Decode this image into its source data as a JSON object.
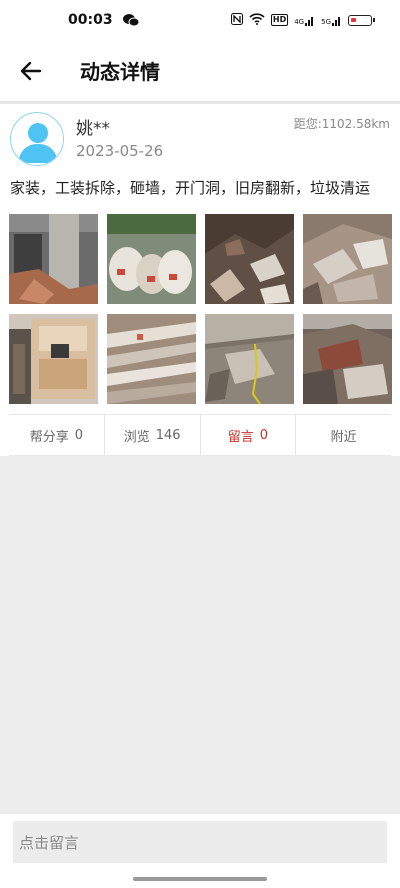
{
  "status_bar": {
    "time": "00:03",
    "hd_label": "HD",
    "signal_label_1": "4G",
    "signal_label_2": "5G"
  },
  "header": {
    "title": "动态详情"
  },
  "post": {
    "username": "姚**",
    "date": "2023-05-26",
    "distance": "距您:1102.58km",
    "description": "家装，工装拆除，砸墙，开门洞，旧房翻新，垃圾清运",
    "photos": [
      "debris-doorway-photo",
      "rubble-bags-photo",
      "broken-tiles-photo",
      "debris-pile-photo",
      "cabinet-room-photo",
      "wood-planks-photo",
      "rubble-floor-photo",
      "mixed-debris-photo"
    ]
  },
  "stats": {
    "share_label": "帮分享",
    "share_count": "0",
    "views_label": "浏览",
    "views_count": "146",
    "comments_label": "留言",
    "comments_count": "0",
    "nearby_label": "附近"
  },
  "comment": {
    "placeholder": "点击留言"
  },
  "colors": {
    "accent_red": "#c9312c",
    "avatar_blue": "#4fc3f1",
    "background": "#ededed"
  }
}
